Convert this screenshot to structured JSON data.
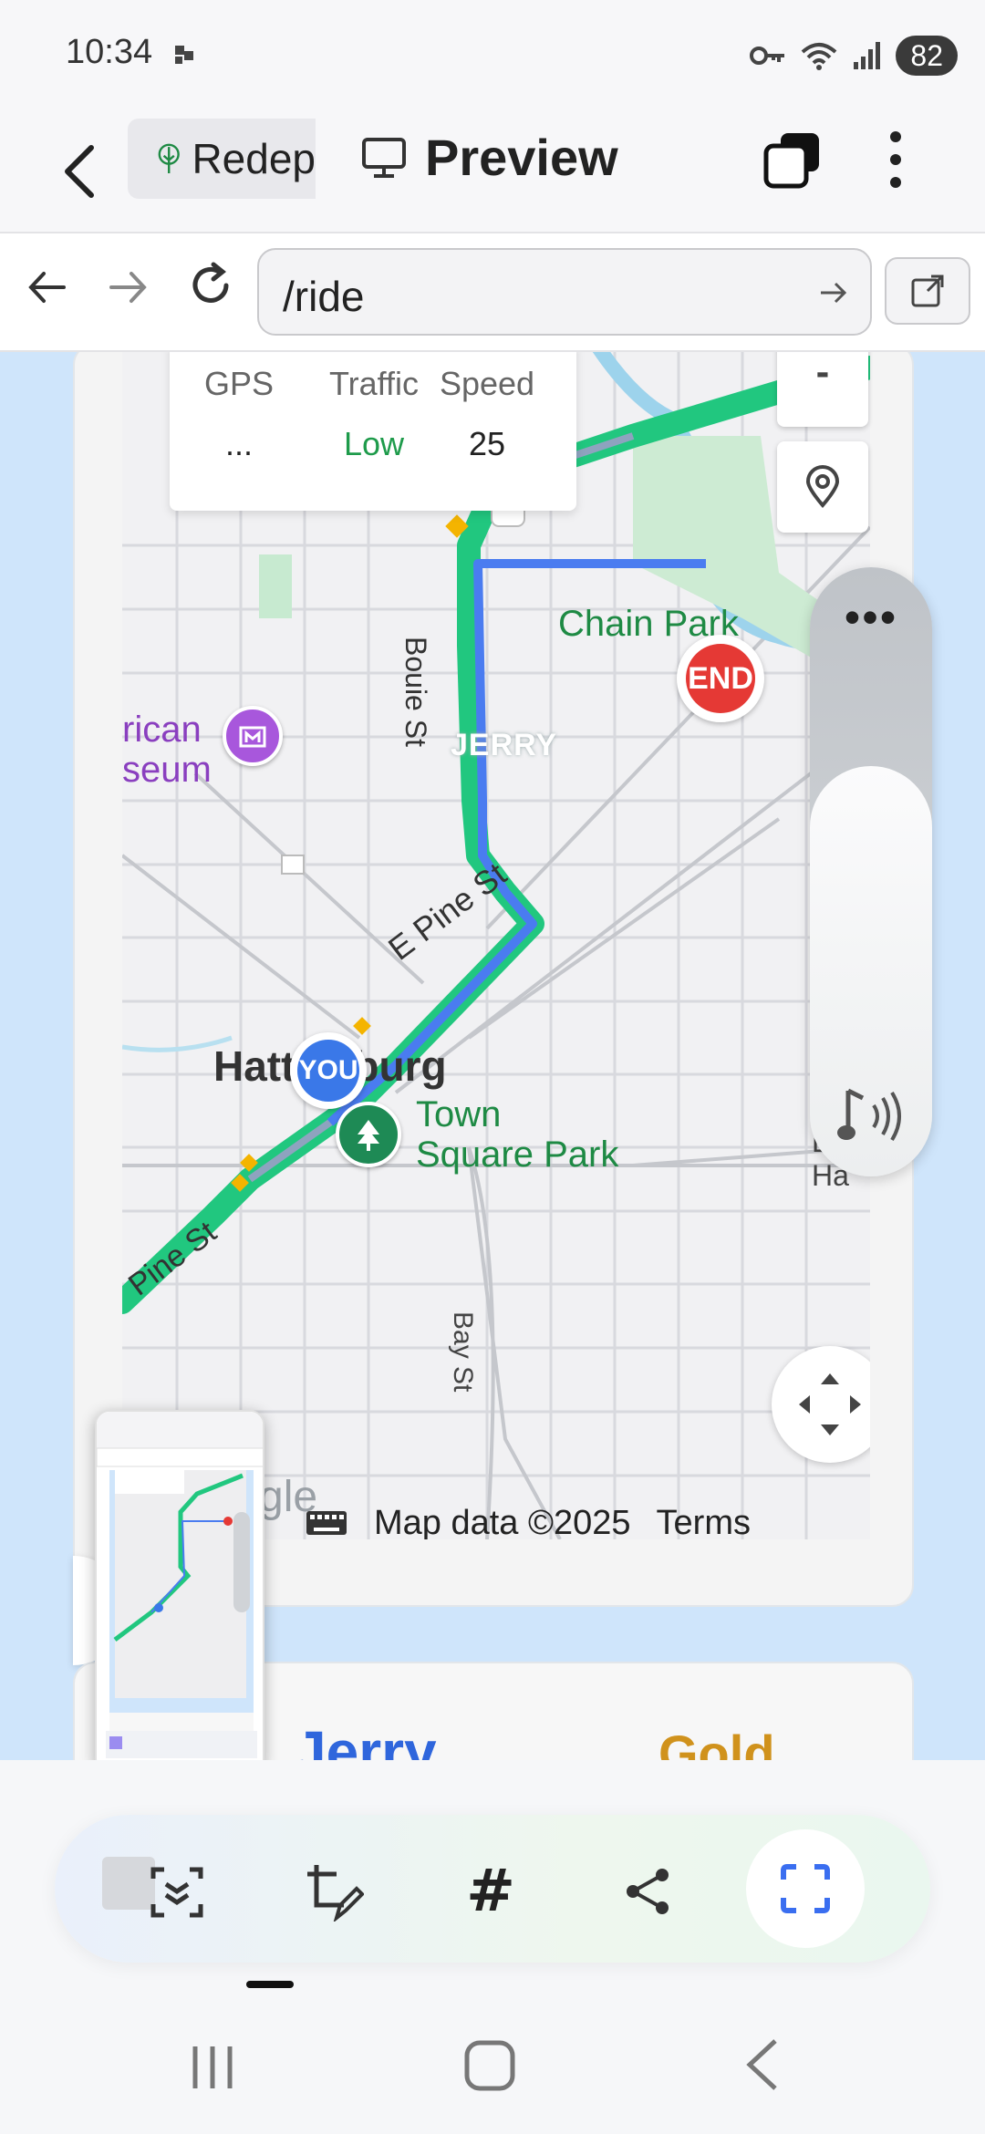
{
  "status_bar": {
    "time": "10:34",
    "battery": "82"
  },
  "header": {
    "project_label": "Redep",
    "preview_label": "Preview"
  },
  "url_bar": {
    "path": "/ride"
  },
  "map": {
    "info": {
      "gps_label": "GPS",
      "traffic_label": "Traffic",
      "speed_label": "Speed",
      "gps_value": "...",
      "traffic_value": "Low",
      "speed_value": "25"
    },
    "labels": {
      "chain_park": "Chain Park",
      "end_marker": "END",
      "you_marker": "YOU",
      "city": "Hattiesburg",
      "jerry": "JERRY",
      "museum_1": "rican",
      "museum_2": "seum",
      "town_square_1": "Town",
      "town_square_2": "Square Park",
      "e_pine_st": "E Pine St",
      "pine_st": "Pine St",
      "bouie": "Bouie St",
      "bay_st": "Bay St",
      "e_hardy": "E Ha"
    },
    "attribution": "Map data ©2025",
    "terms": "Terms",
    "google_fragment": "gle"
  },
  "driver": {
    "name": "Jerry",
    "tier": "Gold"
  },
  "colors": {
    "route_green": "#21c77f",
    "route_blue": "#4a7cf0",
    "end_red": "#e53935",
    "driver_blue": "#2f66dc",
    "gold": "#d0921c",
    "traffic_low": "#1e9b4b"
  }
}
